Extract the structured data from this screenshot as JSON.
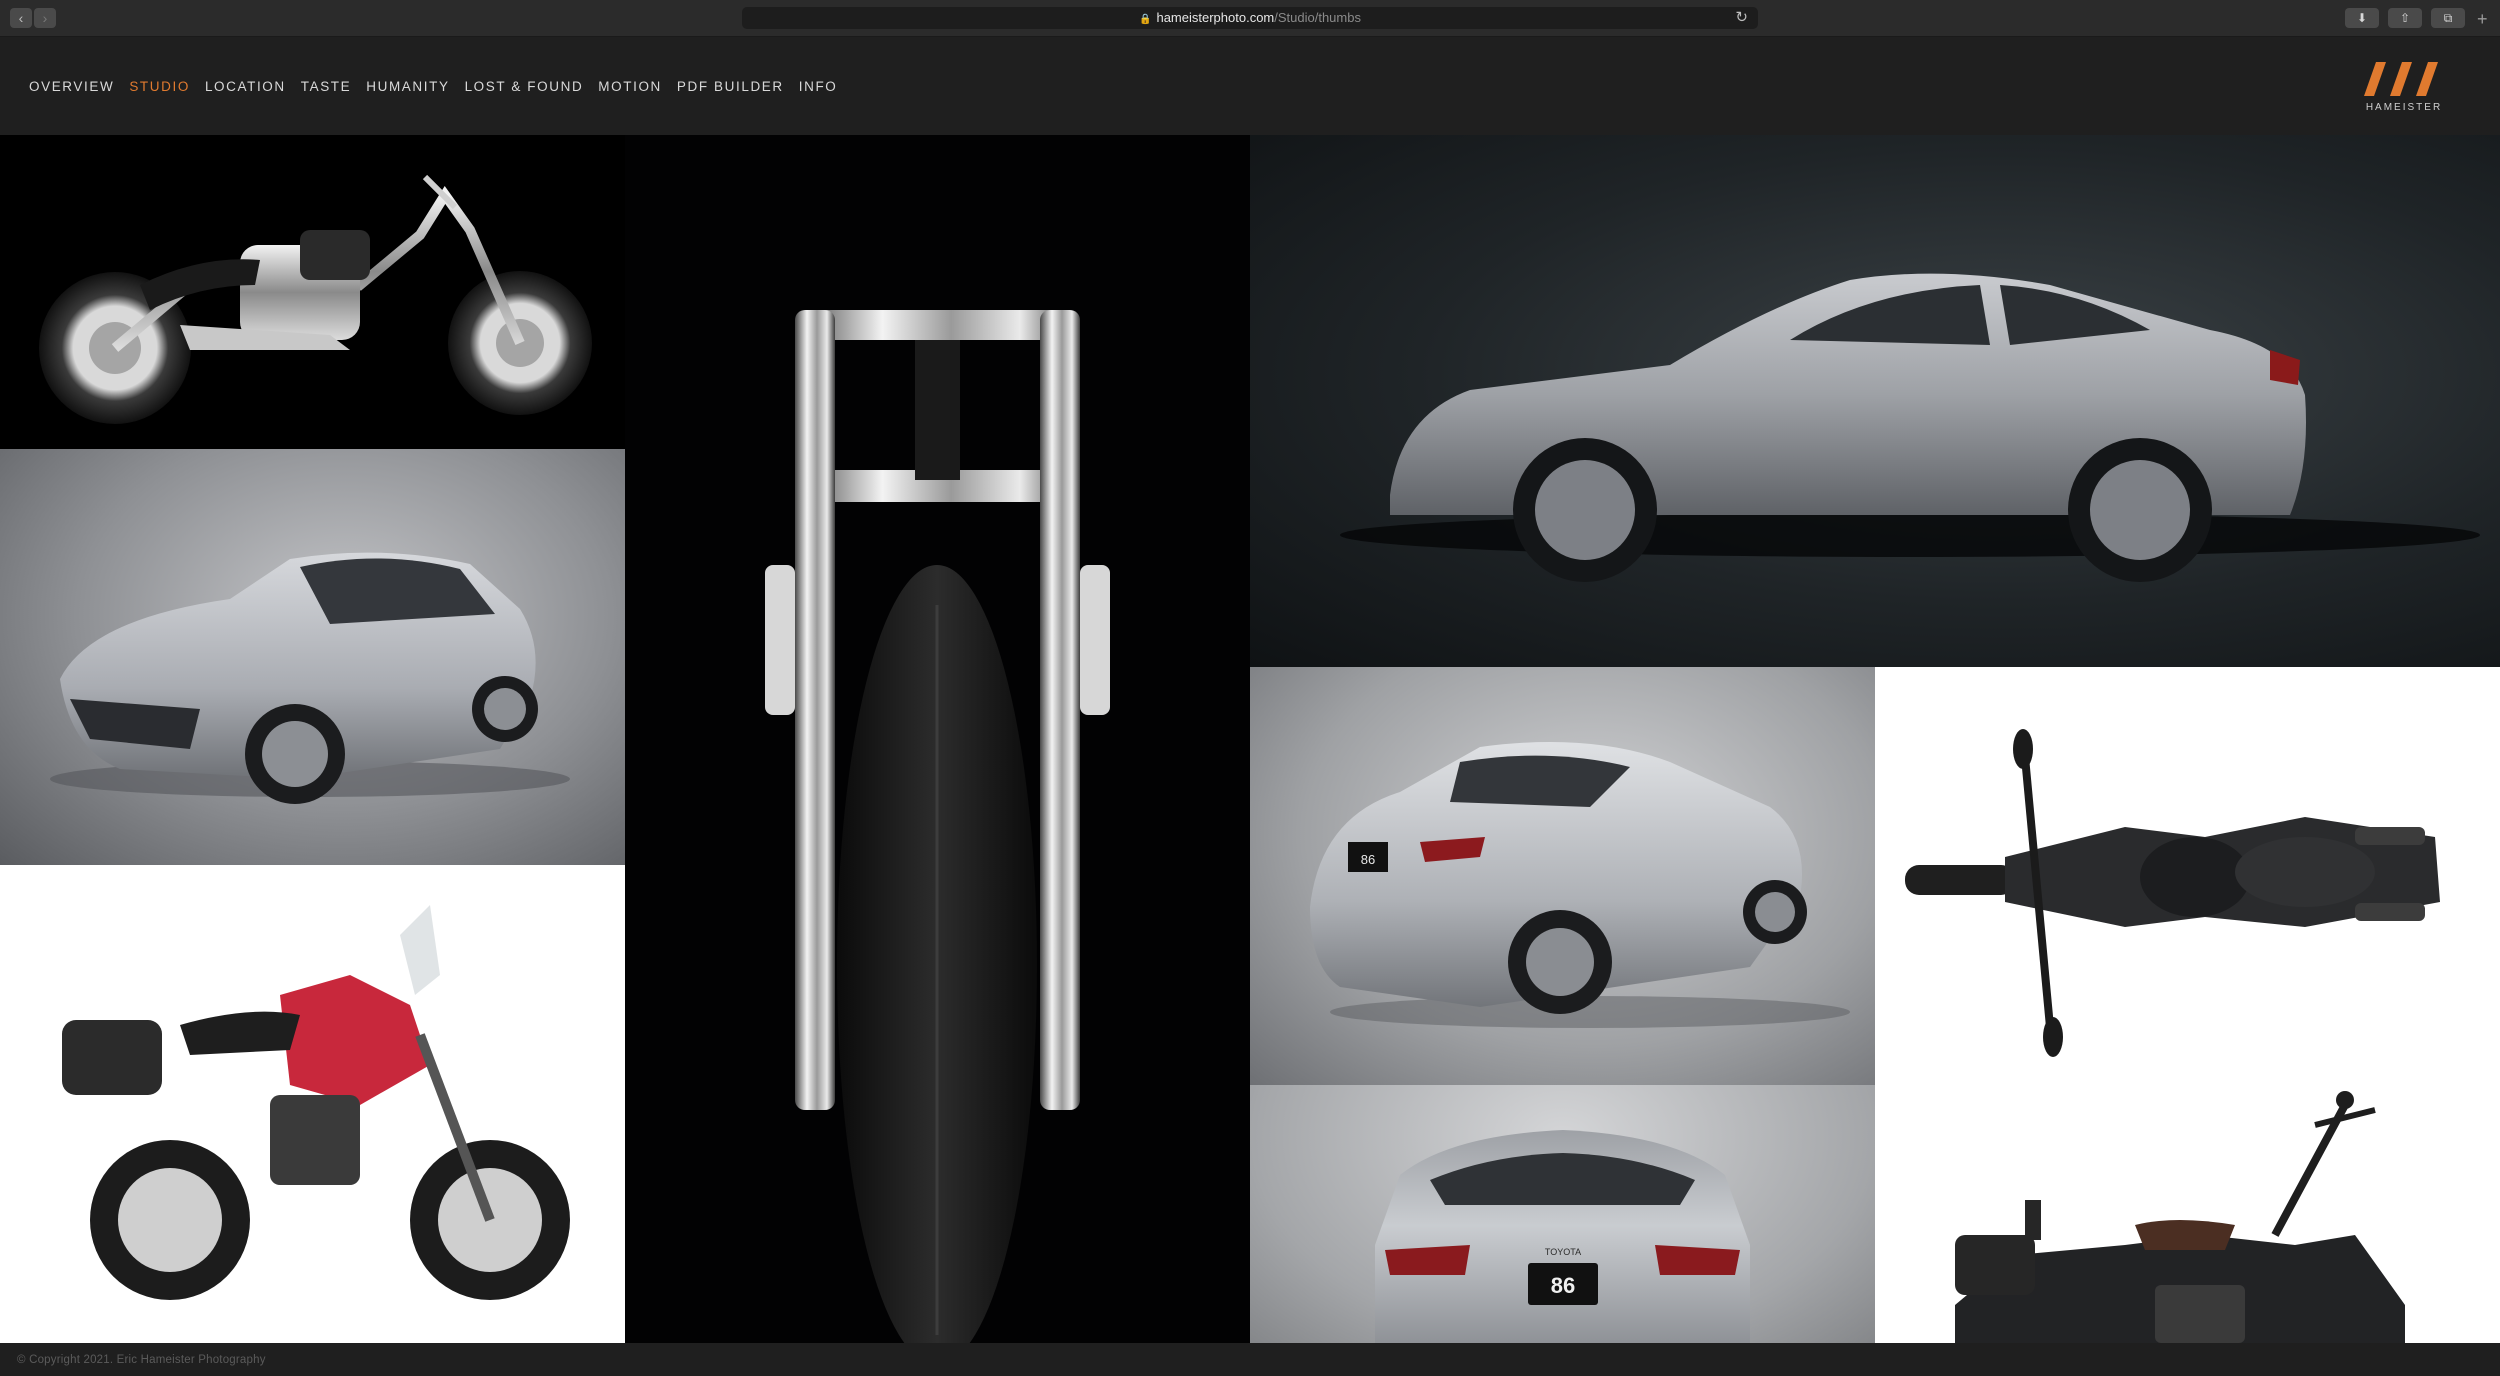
{
  "browser": {
    "url_host": "hameisterphoto.com",
    "url_path": "/Studio/thumbs",
    "back_icon": "chevron-left-icon",
    "forward_icon": "chevron-right-icon",
    "reload_icon": "reload-icon",
    "download_icon": "download-icon",
    "share_icon": "share-icon",
    "tabs_icon": "tabs-icon",
    "new_tab_icon": "plus-icon"
  },
  "site": {
    "menu": [
      "OVERVIEW",
      "STUDIO",
      "LOCATION",
      "TASTE",
      "HUMANITY",
      "LOST & FOUND",
      "MOTION",
      "PDF BUILDER",
      "INFO"
    ],
    "active_menu": "STUDIO",
    "logo_text": "HAMEISTER",
    "accent_color": "#e07a2f"
  },
  "gallery": {
    "tiles": [
      {
        "id": "custom-chopper-motorcycle",
        "bg": "black"
      },
      {
        "id": "silver-sports-car-front-three-quarter",
        "bg": "grey"
      },
      {
        "id": "red-adventure-motorcycle",
        "bg": "white"
      },
      {
        "id": "motorcycle-front-fork-closeup",
        "bg": "black"
      },
      {
        "id": "silver-sports-car-side-profile",
        "bg": "dark"
      },
      {
        "id": "silver-sports-car-rear-three-quarter",
        "bg": "grey",
        "plate": "86"
      },
      {
        "id": "black-cruiser-motorcycle-top-view",
        "bg": "white"
      },
      {
        "id": "silver-sports-car-rear",
        "bg": "grey",
        "plate": "86",
        "badge": "TOYOTA"
      },
      {
        "id": "black-cruiser-motorcycle-side",
        "bg": "white"
      }
    ]
  },
  "footer": {
    "copyright": "© Copyright 2021. Eric Hameister Photography"
  }
}
